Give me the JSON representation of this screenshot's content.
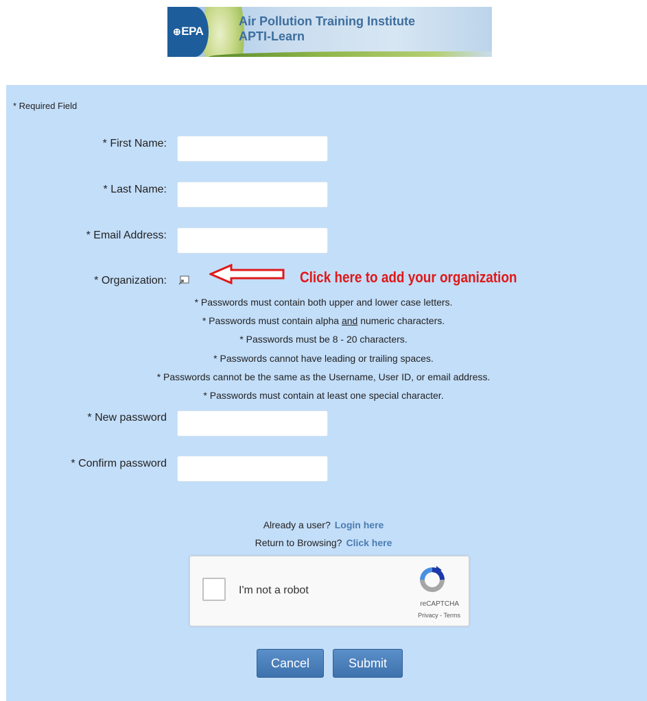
{
  "banner": {
    "agency": "EPA",
    "title": "Air Pollution Training Institute",
    "subtitle": "APTI-Learn"
  },
  "form": {
    "required_note": "* Required Field",
    "first_name_label": "* First Name:",
    "last_name_label": "* Last Name:",
    "email_label": "* Email Address:",
    "organization_label": "* Organization:",
    "organization_icon": "lookup-icon",
    "annotation": "Click here to add your organization",
    "rules": [
      "* Passwords must contain both upper and lower case letters.",
      "* Passwords must contain alpha ",
      "* Passwords must be 8 - 20 characters.",
      "* Passwords cannot have leading or trailing spaces.",
      "* Passwords cannot be the same as the Username, User ID, or email address.",
      "* Passwords must contain at least one special character."
    ],
    "rule2_and": "and",
    "rule2_tail": " numeric characters.",
    "new_password_label": "* New password",
    "confirm_password_label": "* Confirm password"
  },
  "links": {
    "already_user": "Already a user?",
    "login": "Login here",
    "return_browsing": "Return to Browsing?",
    "click_here": "Click here"
  },
  "captcha": {
    "label": "I'm not a robot",
    "brand": "reCAPTCHA",
    "terms": "Privacy - Terms"
  },
  "buttons": {
    "cancel": "Cancel",
    "submit": "Submit"
  },
  "colors": {
    "panel_bg": "#c3def9",
    "annotation": "#e01818",
    "link": "#4a7cb0",
    "button": "#3e72ad"
  }
}
